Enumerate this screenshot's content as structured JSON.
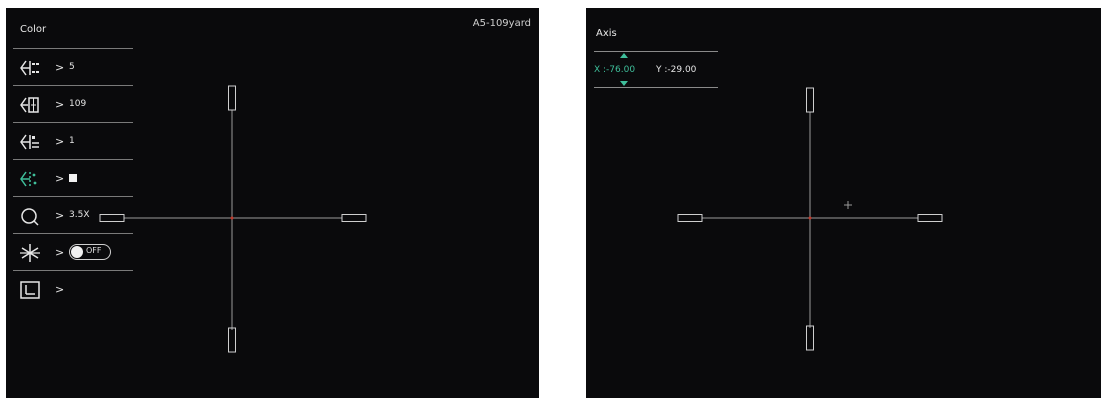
{
  "left_screen": {
    "menu_title": "Color",
    "profile_label": "A5-109yard",
    "menu_items": [
      {
        "icon": "reticle-color-icon",
        "value": "5"
      },
      {
        "icon": "reticle-distance-icon",
        "value": "109"
      },
      {
        "icon": "reticle-format-icon",
        "value": "1"
      },
      {
        "icon": "reticle-color-select-icon",
        "value": "",
        "active": true
      },
      {
        "icon": "zoom-icon",
        "value": "3.5X"
      },
      {
        "icon": "freeze-icon",
        "value": "OFF"
      },
      {
        "icon": "axis-adjust-icon",
        "value": ""
      }
    ],
    "arrow": ">"
  },
  "right_screen": {
    "axis_title": "Axis",
    "x_label": "X :-76.00",
    "y_label": "Y :-29.00"
  },
  "colors": {
    "accent": "#3fbf9b",
    "reticle_line": "#bdbdbd",
    "reticle_center": "#c0392b"
  }
}
